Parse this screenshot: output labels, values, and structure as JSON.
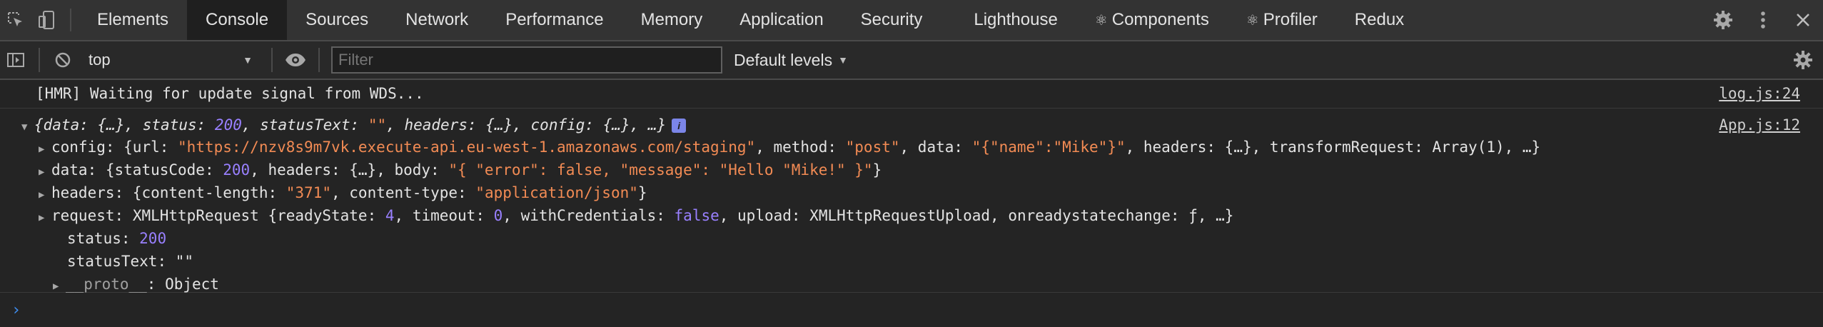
{
  "tabs": [
    {
      "label": "Elements",
      "active": false,
      "react": false
    },
    {
      "label": "Console",
      "active": true,
      "react": false
    },
    {
      "label": "Sources",
      "active": false,
      "react": false
    },
    {
      "label": "Network",
      "active": false,
      "react": false
    },
    {
      "label": "Performance",
      "active": false,
      "react": false
    },
    {
      "label": "Memory",
      "active": false,
      "react": false
    },
    {
      "label": "Application",
      "active": false,
      "react": false
    },
    {
      "label": "Security",
      "active": false,
      "react": false
    },
    {
      "label": "Lighthouse",
      "active": false,
      "react": false
    },
    {
      "label": "Components",
      "active": false,
      "react": true
    },
    {
      "label": "Profiler",
      "active": false,
      "react": true
    },
    {
      "label": "Redux",
      "active": false,
      "react": false
    }
  ],
  "react_glyph": "⚛",
  "toolbar": {
    "context": "top",
    "filter_placeholder": "Filter",
    "levels": "Default levels"
  },
  "console": {
    "msg1": {
      "text": "[HMR] Waiting for update signal from WDS...",
      "source": "log.js:24"
    },
    "msg2": {
      "source": "App.js:12",
      "summary": {
        "open": "{",
        "data_key": "data",
        "data_val": "{…}",
        "status_key": "status",
        "status_val": "200",
        "statusText_key": "statusText",
        "statusText_val": "\"\"",
        "headers_key": "headers",
        "headers_val": "{…}",
        "config_key": "config",
        "config_val": "{…}",
        "rest": "…}",
        "badge": "i"
      },
      "config": {
        "key": "config",
        "url_key": "url",
        "url": "\"https://nzv8s9m7vk.execute-api.eu-west-1.amazonaws.com/staging\"",
        "method_key": "method",
        "method": "\"post\"",
        "data_key": "data",
        "data": "\"{\"name\":\"Mike\"}\"",
        "tail": ", headers: {…}, transformRequest: Array(1), …}"
      },
      "data": {
        "key": "data",
        "statusCode_key": "statusCode",
        "statusCode": "200",
        "headers": ", headers: {…}, body: ",
        "body": "\"{ \"error\": false, \"message\": \"Hello \"Mike!\" }\"",
        "close": "}"
      },
      "headers": {
        "key": "headers",
        "cl_key": "content-length",
        "cl": "\"371\"",
        "ct_key": "content-type",
        "ct": "\"application/json\"",
        "close": "}"
      },
      "request": {
        "key": "request",
        "type": "XMLHttpRequest",
        "rs_key": "readyState",
        "rs": "4",
        "to_key": "timeout",
        "to": "0",
        "wc_key": "withCredentials",
        "wc": "false",
        "tail": ", upload: XMLHttpRequestUpload, onreadystatechange: ƒ, …}"
      },
      "status": {
        "key": "status",
        "value": "200"
      },
      "statusText": {
        "key": "statusText",
        "value": "\"\""
      },
      "proto": {
        "key": "__proto__",
        "value": "Object"
      }
    },
    "prompt": "›"
  }
}
